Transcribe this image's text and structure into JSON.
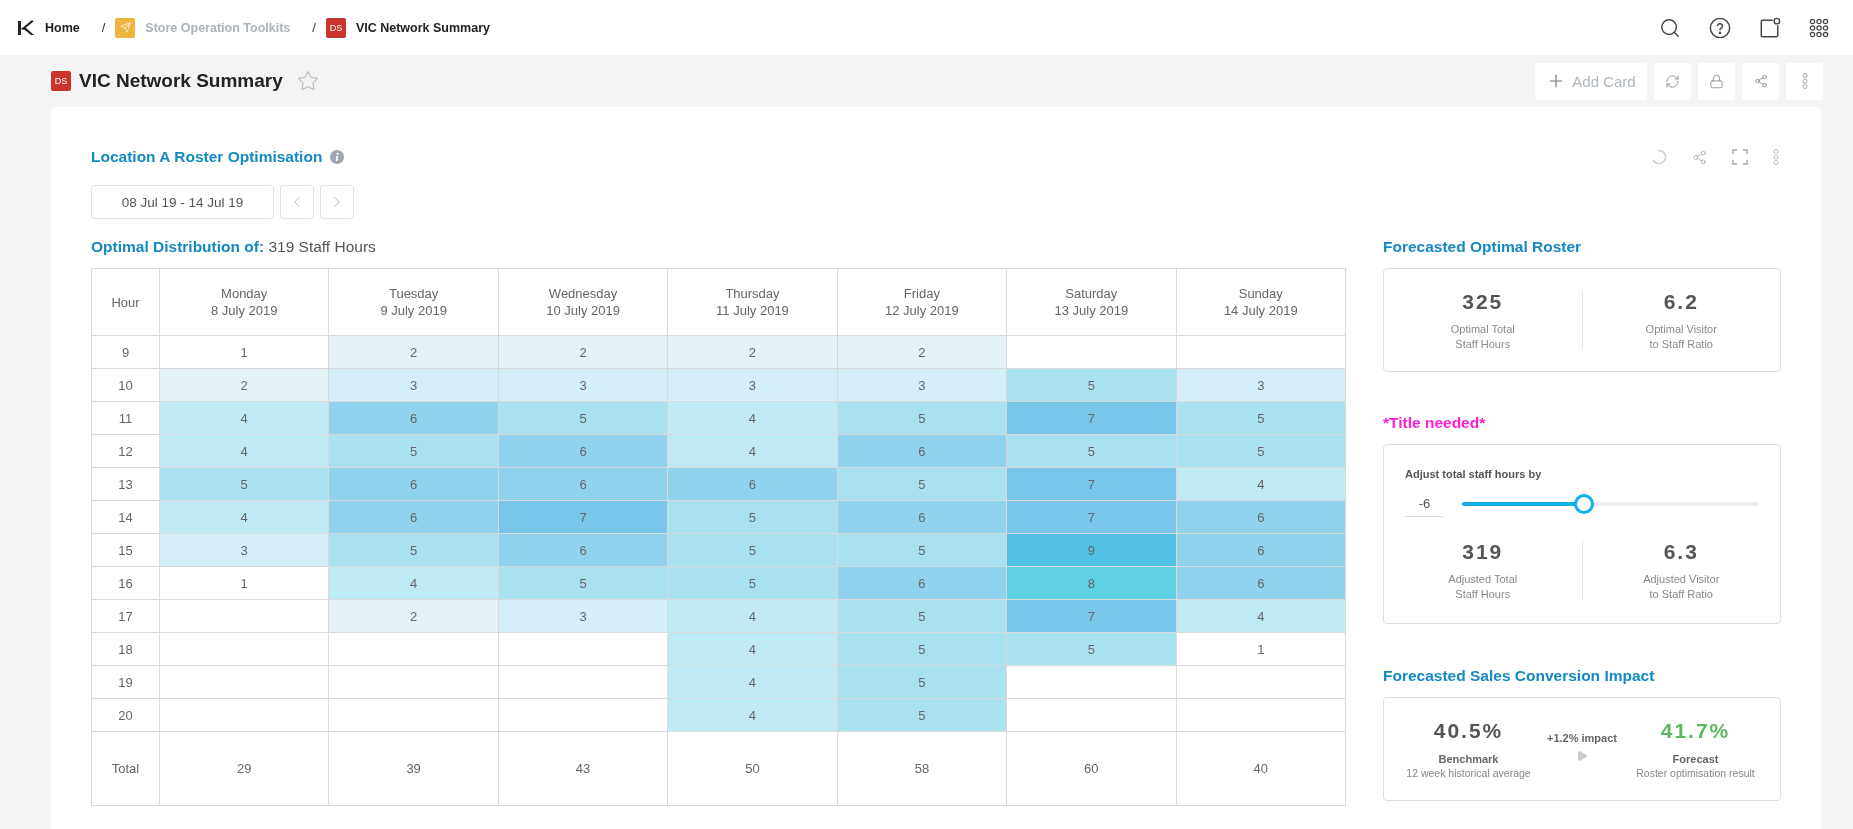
{
  "breadcrumbs": [
    {
      "kind": "home",
      "label": "Home"
    },
    {
      "kind": "folder",
      "separator": "/",
      "label": "Store Operation Toolkits"
    },
    {
      "kind": "dashboard",
      "separator": "/",
      "badge": "DS",
      "label": "VIC Network Summary"
    }
  ],
  "page": {
    "badge": "DS",
    "title": "VIC Network Summary",
    "starred": false,
    "add_card": "Add Card"
  },
  "card": {
    "title": "Location A Roster Optimisation",
    "date_range": "08 Jul 19 - 14 Jul 19",
    "distribution": {
      "label": "Optimal Distribution of:",
      "value": "319 Staff Hours"
    },
    "table": {
      "columns": [
        {
          "label": "Hour"
        },
        {
          "label": "Monday",
          "date": "8 July 2019"
        },
        {
          "label": "Tuesday",
          "date": "9 July 2019"
        },
        {
          "label": "Wednesday",
          "date": "10 July 2019"
        },
        {
          "label": "Thursday",
          "date": "11 July 2019"
        },
        {
          "label": "Friday",
          "date": "12 July 2019"
        },
        {
          "label": "Saturday",
          "date": "13 July 2019"
        },
        {
          "label": "Sunday",
          "date": "14 July 2019"
        }
      ],
      "rows": [
        {
          "kind": "hour",
          "cells": [
            "9",
            "1",
            "2",
            "2",
            "2",
            "2",
            "",
            ""
          ]
        },
        {
          "kind": "hour",
          "cells": [
            "10",
            "2",
            "3",
            "3",
            "3",
            "3",
            "5",
            "3"
          ]
        },
        {
          "kind": "hour",
          "cells": [
            "11",
            "4",
            "6",
            "5",
            "4",
            "5",
            "7",
            "5"
          ]
        },
        {
          "kind": "hour",
          "cells": [
            "12",
            "4",
            "5",
            "6",
            "4",
            "6",
            "5",
            "5"
          ]
        },
        {
          "kind": "hour",
          "cells": [
            "13",
            "5",
            "6",
            "6",
            "6",
            "5",
            "7",
            "4"
          ]
        },
        {
          "kind": "hour",
          "cells": [
            "14",
            "4",
            "6",
            "7",
            "5",
            "6",
            "7",
            "6"
          ]
        },
        {
          "kind": "hour",
          "cells": [
            "15",
            "3",
            "5",
            "6",
            "5",
            "5",
            "9",
            "6"
          ]
        },
        {
          "kind": "hour",
          "cells": [
            "16",
            "1",
            "4",
            "5",
            "5",
            "6",
            "8",
            "6"
          ]
        },
        {
          "kind": "hour",
          "cells": [
            "17",
            "",
            "2",
            "3",
            "4",
            "5",
            "7",
            "4"
          ]
        },
        {
          "kind": "hour",
          "cells": [
            "18",
            "",
            "",
            "",
            "4",
            "5",
            "5",
            "1"
          ]
        },
        {
          "kind": "hour",
          "cells": [
            "19",
            "",
            "",
            "",
            "4",
            "5",
            "",
            ""
          ]
        },
        {
          "kind": "hour",
          "cells": [
            "20",
            "",
            "",
            "",
            "4",
            "5",
            "",
            ""
          ]
        },
        {
          "kind": "total",
          "cells": [
            "Total",
            "29",
            "39",
            "43",
            "50",
            "58",
            "60",
            "40"
          ]
        }
      ]
    }
  },
  "panels": [
    {
      "kind": "stats",
      "title": "Forecasted Optimal Roster",
      "placeholder_title": false,
      "stats": [
        {
          "value": "325",
          "label": "Optimal Total\nStaff Hours"
        },
        {
          "value": "6.2",
          "label": "Optimal Visitor\nto Staff Ratio"
        }
      ]
    },
    {
      "kind": "adjust",
      "title": "*Title needed*",
      "placeholder_title": true,
      "slider": {
        "label": "Adjust total staff hours by",
        "value": "-6",
        "level": 0.41
      },
      "stats": [
        {
          "value": "319",
          "label": "Adjusted Total\nStaff Hours"
        },
        {
          "value": "6.3",
          "label": "Adjusted Visitor\nto Staff Ratio"
        }
      ]
    },
    {
      "kind": "impact",
      "title": "Forecasted Sales Conversion Impact",
      "placeholder_title": false,
      "impact": "+1.2% impact",
      "results": [
        {
          "kind": "benchmark",
          "value": "40.5%",
          "label": "Benchmark",
          "note": "12 week historical average"
        },
        {
          "kind": "forecast",
          "value": "41.7%",
          "label": "Forecast",
          "note": "Roster optimisation result"
        }
      ]
    }
  ]
}
